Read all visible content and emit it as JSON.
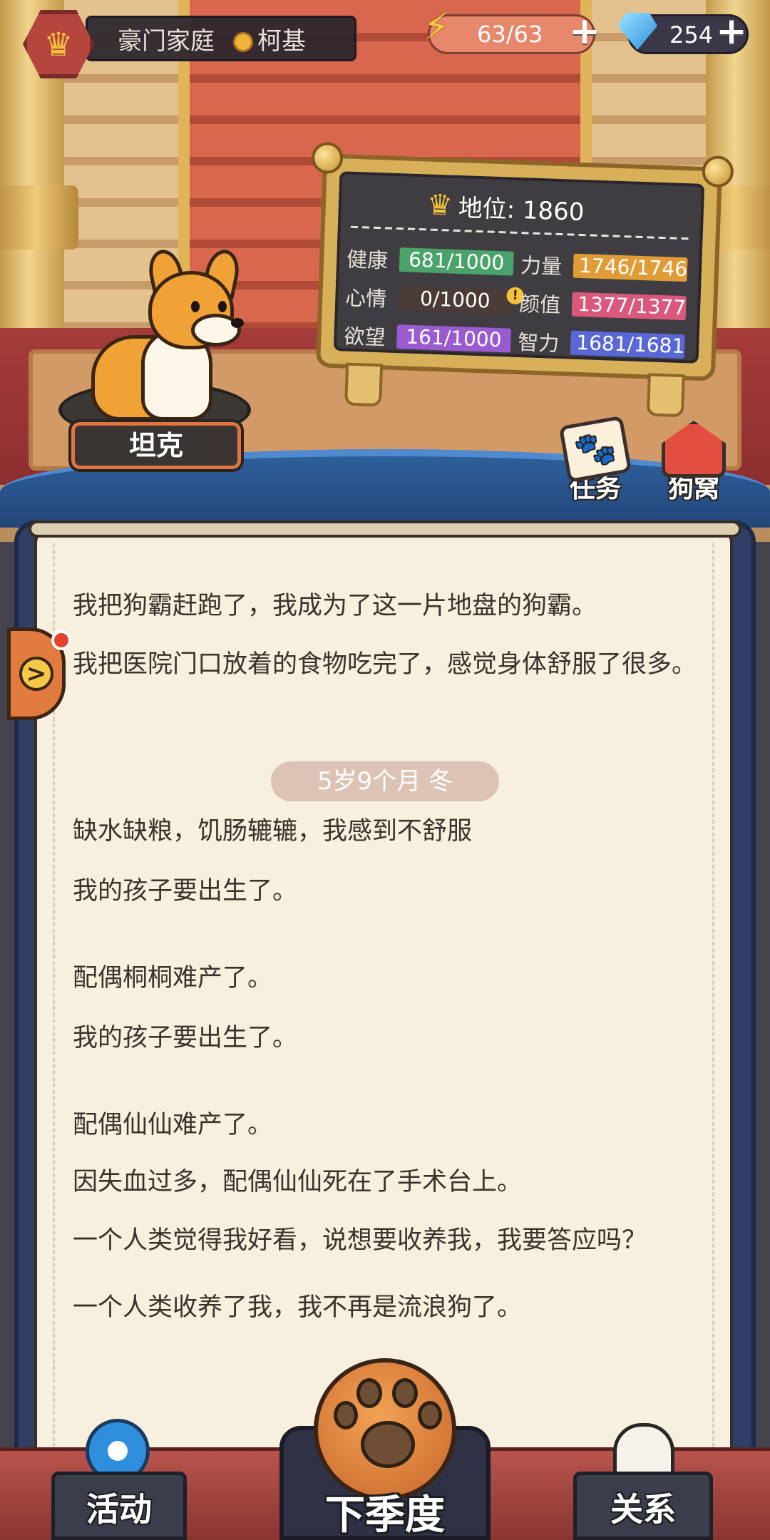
{
  "hud": {
    "family_title": "豪门家庭",
    "breed": "柯基",
    "energy": "63/63",
    "gems": "254",
    "plus_symbol": "+"
  },
  "status_board": {
    "status_label": "地位: 1860",
    "stats": [
      {
        "label": "健康",
        "value": "681/1000",
        "color": "#4aa36b"
      },
      {
        "label": "心情",
        "value": "0/1000",
        "color": "#4a3b36"
      },
      {
        "label": "欲望",
        "value": "161/1000",
        "color": "#9b5bd0"
      },
      {
        "label": "力量",
        "value": "1746/1746",
        "color": "#e09c36"
      },
      {
        "label": "颜值",
        "value": "1377/1377",
        "color": "#d9587c"
      },
      {
        "label": "智力",
        "value": "1681/1681",
        "color": "#5968d6"
      }
    ],
    "warning_symbol": "!"
  },
  "dog": {
    "name": "坦克"
  },
  "shortcuts": {
    "tasks": "任务",
    "kennel": "狗窝"
  },
  "log": {
    "lines_before": [
      "我把狗霸赶跑了，我成为了这一片地盘的狗霸。",
      "我把医院门口放着的食物吃完了，感觉身体舒服了很多。"
    ],
    "season_tag": "5岁9个月 冬",
    "lines_after": [
      "缺水缺粮，饥肠辘辘，我感到不舒服",
      "我的孩子要出生了。",
      "配偶桐桐难产了。",
      "我的孩子要出生了。",
      "配偶仙仙难产了。",
      "因失血过多，配偶仙仙死在了手术台上。",
      "一个人类觉得我好看，说想要收养我，我要答应吗？",
      "一个人类收养了我，我不再是流浪狗了。"
    ],
    "expand_symbol": ">"
  },
  "bottom_nav": {
    "activity": "活动",
    "next_season": "下季度",
    "relations": "关系"
  },
  "colors": {
    "accent": "#e0743c",
    "paper": "#f7f0df"
  }
}
